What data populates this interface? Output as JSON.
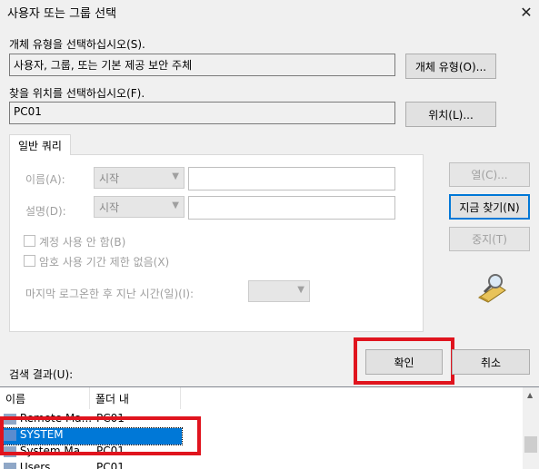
{
  "window": {
    "title": "사용자 또는 그룹 선택",
    "close_glyph": "✕"
  },
  "object_type": {
    "label": "개체 유형을 선택하십시오(S).",
    "value": "사용자, 그룹, 또는 기본 제공 보안 주체",
    "button": "개체 유형(O)..."
  },
  "location": {
    "label": "찾을 위치를 선택하십시오(F).",
    "value": "PC01",
    "button": "위치(L)..."
  },
  "query": {
    "tab_label": "일반 쿼리",
    "name_label": "이름(A):",
    "name_combo": "시작",
    "desc_label": "설명(D):",
    "desc_combo": "시작",
    "disabled_accounts": "계정 사용 안 함(B)",
    "non_expiring_pw": "암호 사용 기간 제한 없음(X)",
    "days_since_logon": "마지막 로그온한 후 지난 시간(일)(I):"
  },
  "side_buttons": {
    "columns": "열(C)...",
    "find_now": "지금 찾기(N)",
    "stop": "중지(T)"
  },
  "footer": {
    "results_label": "검색 결과(U):",
    "ok": "확인",
    "cancel": "취소"
  },
  "results": {
    "columns": [
      "이름",
      "폴더 내"
    ],
    "rows": [
      {
        "name": "Remote Ma...",
        "folder": "PC01",
        "selected": false
      },
      {
        "name": "SYSTEM",
        "folder": "",
        "selected": true
      },
      {
        "name": "System Ma...",
        "folder": "PC01",
        "selected": false
      },
      {
        "name": "Users",
        "folder": "PC01",
        "selected": false
      }
    ]
  },
  "colors": {
    "accent": "#0078d7",
    "highlight_red": "#e0141e",
    "selection": "#0078d7"
  }
}
